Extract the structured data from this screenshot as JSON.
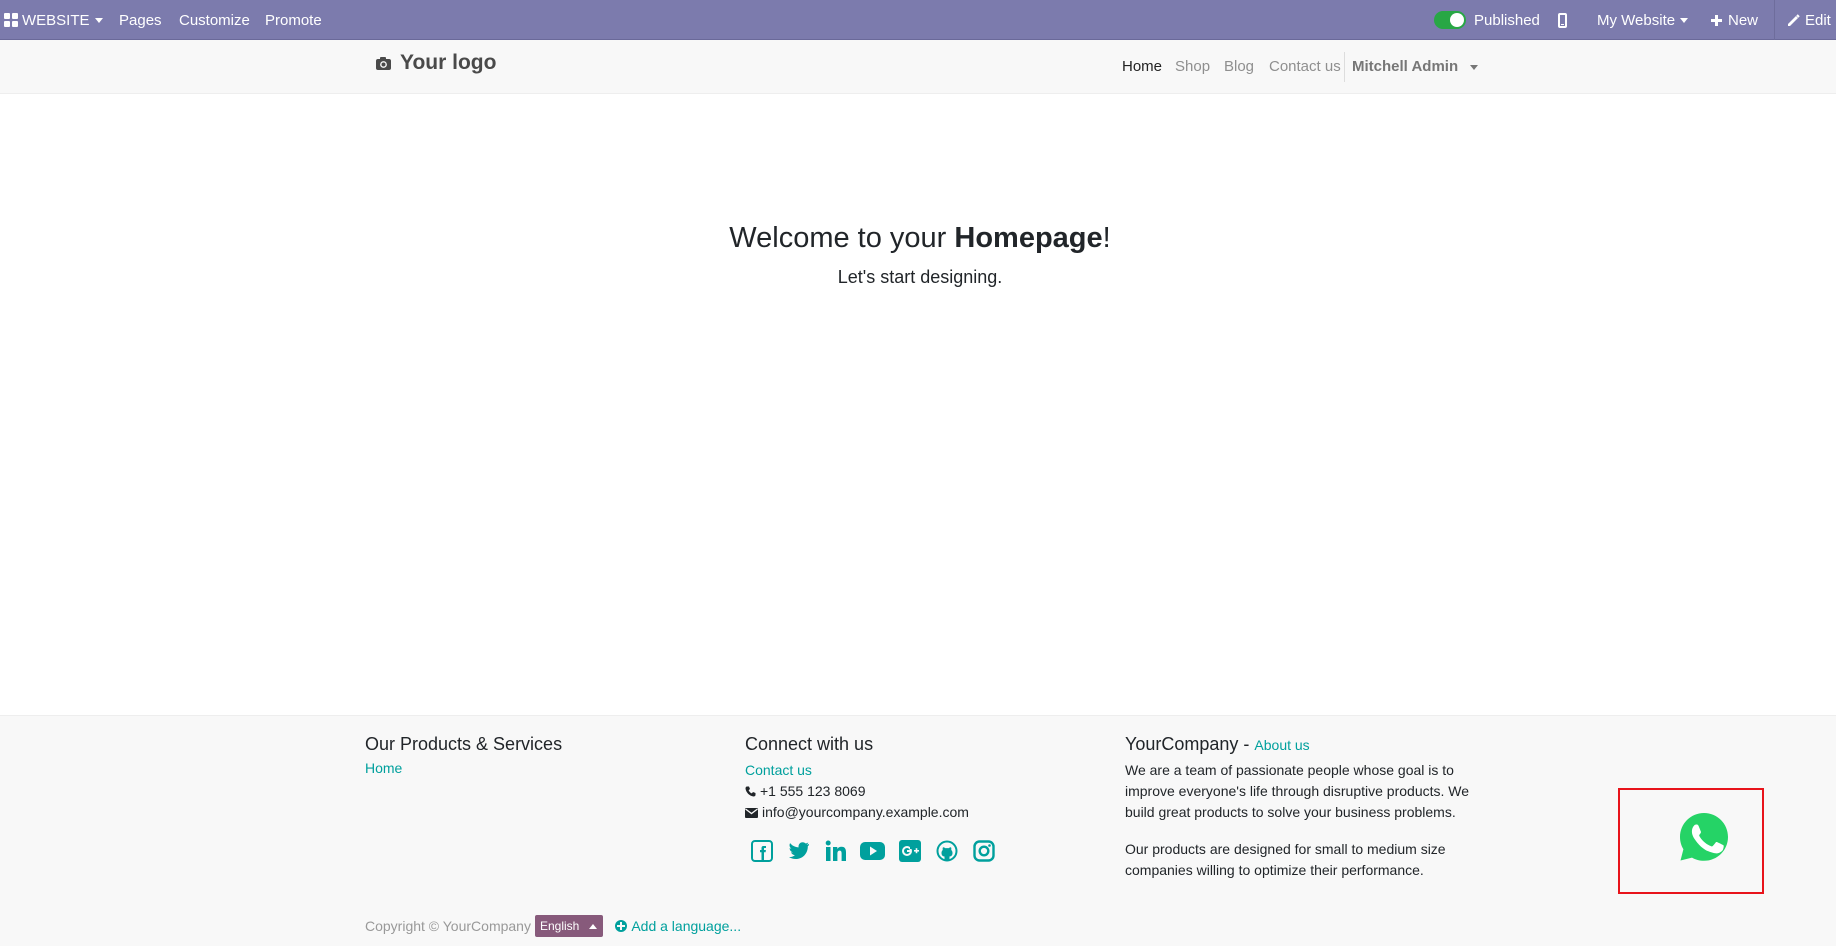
{
  "adminbar": {
    "app_label": "WEBSITE",
    "menu": [
      "Pages",
      "Customize",
      "Promote"
    ],
    "published_label": "Published",
    "website_label": "My Website",
    "new_label": "New",
    "edit_label": "Edit",
    "bg_color": "#7c7bad"
  },
  "header": {
    "logo_text": "Your logo",
    "nav": [
      "Home",
      "Shop",
      "Blog",
      "Contact us"
    ],
    "active_nav": "Home",
    "user": "Mitchell Admin"
  },
  "hero": {
    "title_prefix": "Welcome to your ",
    "title_bold": "Homepage",
    "title_suffix": "!",
    "subtitle": "Let's start designing."
  },
  "footer": {
    "col1": {
      "title": "Our Products & Services",
      "link": "Home"
    },
    "col2": {
      "title": "Connect with us",
      "contact_link": "Contact us",
      "phone": "+1 555 123 8069",
      "email": "info@yourcompany.example.com",
      "social_icons": [
        "facebook-icon",
        "twitter-icon",
        "linkedin-icon",
        "youtube-icon",
        "google-plus-icon",
        "github-icon",
        "instagram-icon"
      ]
    },
    "col3": {
      "title": "YourCompany",
      "separator": " - ",
      "about_link": "About us",
      "para1": "We are a team of passionate people whose goal is to improve everyone's life through disruptive products. We build great products to solve your business problems.",
      "para2": "Our products are designed for small to medium size companies willing to optimize their performance."
    },
    "copyright": "Copyright © YourCompany",
    "language": "English",
    "add_language": "Add a language...",
    "link_color": "#00a09d"
  },
  "whatsapp": {
    "icon": "whatsapp-icon",
    "color": "#25d366",
    "highlight_color": "#e8141b"
  }
}
